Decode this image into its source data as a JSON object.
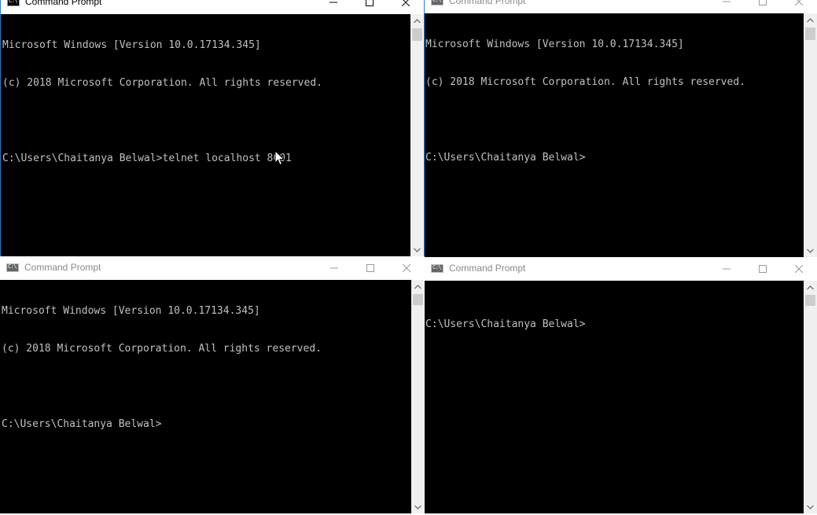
{
  "windows": [
    {
      "title": "Command Prompt",
      "active": true,
      "lines": [
        "Microsoft Windows [Version 10.0.17134.345]",
        "(c) 2018 Microsoft Corporation. All rights reserved.",
        "",
        "C:\\Users\\Chaitanya Belwal>telnet localhost 8001"
      ]
    },
    {
      "title": "Command Prompt",
      "active": false,
      "lines": [
        "Microsoft Windows [Version 10.0.17134.345]",
        "(c) 2018 Microsoft Corporation. All rights reserved.",
        "",
        "C:\\Users\\Chaitanya Belwal>"
      ]
    },
    {
      "title": "Command Prompt",
      "active": false,
      "lines": [
        "Microsoft Windows [Version 10.0.17134.345]",
        "(c) 2018 Microsoft Corporation. All rights reserved.",
        "",
        "C:\\Users\\Chaitanya Belwal>"
      ]
    },
    {
      "title": "Command Prompt",
      "active": false,
      "lines": [
        "C:\\Users\\Chaitanya Belwal>"
      ]
    }
  ],
  "icons": {
    "app": "cmd-icon",
    "minimize": "minimize-icon",
    "maximize": "maximize-icon",
    "close": "close-icon",
    "pointer": "mouse-pointer-icon"
  },
  "colors": {
    "console_bg": "#000000",
    "console_text": "#c0c0c0",
    "active_border": "#2b79c2",
    "inactive_title": "#8a8a8a"
  }
}
